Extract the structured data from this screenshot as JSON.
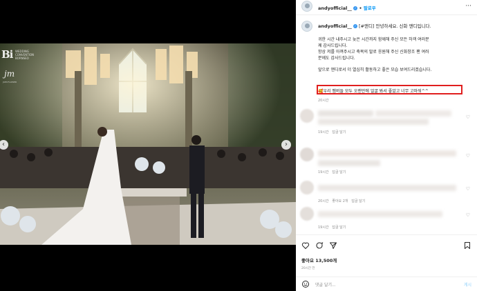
{
  "media": {
    "watermark_logo": "Bi",
    "watermark_sub": "WEDDING CONVENTION BORNSEO",
    "watermark_script": "jm",
    "watermark_script_sub": "JIUM FLOWER",
    "prev_arrow": "‹",
    "next_arrow": "›"
  },
  "header": {
    "username": "andyofficial__",
    "follow_label": "팔로우",
    "more": "···"
  },
  "caption": {
    "username": "andyofficial__",
    "first_line": "[#앤디] 안녕하세요. 신화 앤디입니다.",
    "lines": [
      "귀한 시간 내주시고 늦은 시간까지 함께해 주신 모든 하객 여러분",
      "께 감사드립니다.",
      "항상 저를 아껴주시고 축복의 말로 응원해 주신 신화창조 팬 여러",
      "분께도 감사드립니다.",
      "앞으로 앤디로서 더 열심히 활동하고 좋은 모습 보여드리겠습니다.",
      "🥰우리 멤버들 모두 오랜만에 얼굴 봐서 좋았고 너무 고마워^^"
    ],
    "time": "20시간"
  },
  "comments": [
    {
      "time": "19시간",
      "reply": "답글 달기"
    },
    {
      "time": "19시간",
      "reply": "답글 달기"
    },
    {
      "time": "20시간",
      "likes": "좋아요 2개",
      "reply": "답글 달기"
    },
    {
      "time": "19시간",
      "reply": "답글 달기"
    }
  ],
  "actions": {
    "likes": "좋아요 13,500개",
    "date": "20시간 전"
  },
  "comment_box": {
    "placeholder": "댓글 달기...",
    "post_label": "게시"
  },
  "icons": [
    "heart-icon",
    "comment-icon",
    "share-icon",
    "bookmark-icon",
    "emoji-icon",
    "more-icon",
    "verified-icon"
  ],
  "colors": {
    "accent": "#0095f6",
    "highlight_box": "#e01e1e",
    "muted_text": "#8e8e8e"
  }
}
